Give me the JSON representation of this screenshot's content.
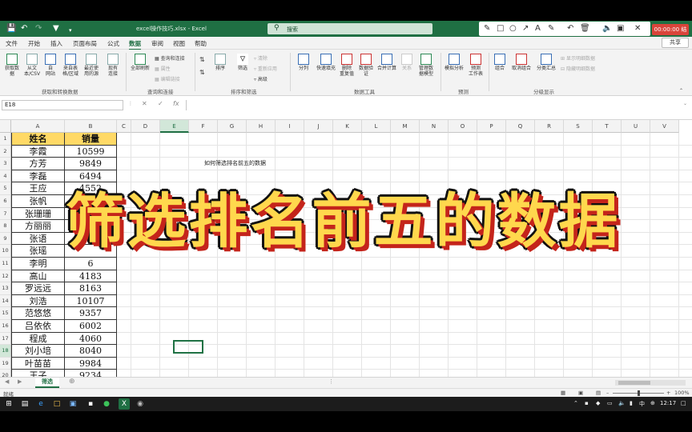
{
  "titlebar": {
    "autosave_icon": "save-icon",
    "undo_icon": "undo-icon",
    "redo_icon": "redo-icon",
    "filter_icon": "filter-icon",
    "title": "excel操作技巧.xlsx - Excel",
    "search_placeholder": "搜索"
  },
  "recording": {
    "label": "00:00:00 结束"
  },
  "menu": {
    "items": [
      "文件",
      "开始",
      "插入",
      "页面布局",
      "公式",
      "数据",
      "审阅",
      "视图",
      "帮助"
    ],
    "active": "数据",
    "share": "共享"
  },
  "ribbon": {
    "get_data": {
      "label1": "获取数",
      "label2": "据",
      "from_text1": "从文",
      "from_text2": "本/CSV",
      "from_web1": "自",
      "from_web2": "网站",
      "from_table1": "来自表",
      "from_table2": "格/区域",
      "recent1": "最近使",
      "recent2": "用的源",
      "existing1": "现有",
      "existing2": "连接",
      "group": "获取和转换数据"
    },
    "queries": {
      "refresh1": "全部刷新",
      "qc": "查询和连接",
      "props": "属性",
      "edit_links": "编辑链接",
      "group": "查询和连接"
    },
    "sort_filter": {
      "sort": "排序",
      "filter": "筛选",
      "clear": "清除",
      "reapply": "重新应用",
      "advanced": "高级",
      "group": "排序和筛选"
    },
    "data_tools": {
      "split": "分列",
      "flash": "快速填充",
      "remove_dup1": "删除",
      "remove_dup2": "重复值",
      "validate1": "数据验",
      "validate2": "证",
      "consolidate": "合并计算",
      "relations": "关系",
      "model1": "管理数",
      "model2": "据模型",
      "group": "数据工具"
    },
    "forecast": {
      "whatif": "模拟分析",
      "sheet1": "预测",
      "sheet2": "工作表",
      "group": "预测"
    },
    "outline": {
      "group_btn": "组合",
      "ungroup": "取消组合",
      "subtotal": "分类汇总",
      "show": "显示明细数据",
      "hide": "隐藏明细数据",
      "group": "分级显示"
    }
  },
  "formula": {
    "namebox": "E18",
    "fx": "fx"
  },
  "columns": [
    "A",
    "B",
    "C",
    "D",
    "E",
    "F",
    "G",
    "H",
    "I",
    "J",
    "K",
    "L",
    "M",
    "N",
    "O",
    "P",
    "Q",
    "R",
    "S",
    "T",
    "U",
    "V"
  ],
  "rows": [
    "1",
    "2",
    "3",
    "4",
    "5",
    "6",
    "7",
    "8",
    "9",
    "10",
    "11",
    "12",
    "13",
    "14",
    "15",
    "16",
    "17",
    "18",
    "19",
    "20"
  ],
  "table": {
    "headers": {
      "name": "姓名",
      "sales": "销量"
    },
    "rows": [
      {
        "name": "李霞",
        "sales": "10599"
      },
      {
        "name": "方芳",
        "sales": "9849"
      },
      {
        "name": "李磊",
        "sales": "6494"
      },
      {
        "name": "王应",
        "sales": "4552"
      },
      {
        "name": "张帆",
        "sales": "3998"
      },
      {
        "name": "张珊珊",
        "sales": ""
      },
      {
        "name": "方丽丽",
        "sales": ""
      },
      {
        "name": "张语",
        "sales": ""
      },
      {
        "name": "张瑶",
        "sales": ""
      },
      {
        "name": "李明",
        "sales": "6"
      },
      {
        "name": "高山",
        "sales": "4183"
      },
      {
        "name": "罗远远",
        "sales": "8163"
      },
      {
        "name": "刘浩",
        "sales": "10107"
      },
      {
        "name": "范悠悠",
        "sales": "9357"
      },
      {
        "name": "吕依依",
        "sales": "6002"
      },
      {
        "name": "程成",
        "sales": "4060"
      },
      {
        "name": "刘小培",
        "sales": "8040"
      },
      {
        "name": "叶苗苗",
        "sales": "9984"
      },
      {
        "name": "王子",
        "sales": "9234"
      }
    ]
  },
  "note": "如何筛选排名前五的数据",
  "overlay": "筛选排名前五的数据",
  "sheet_tab": "筛选",
  "status": {
    "ready": "就绪",
    "zoom": "100%"
  },
  "taskbar": {
    "ime": "中",
    "time": "12:17"
  },
  "colors": {
    "excel_green": "#1f6f43",
    "header_fill": "#ffd966",
    "overlay_text": "#ffd84d",
    "overlay_shadow": "#c4241b"
  }
}
